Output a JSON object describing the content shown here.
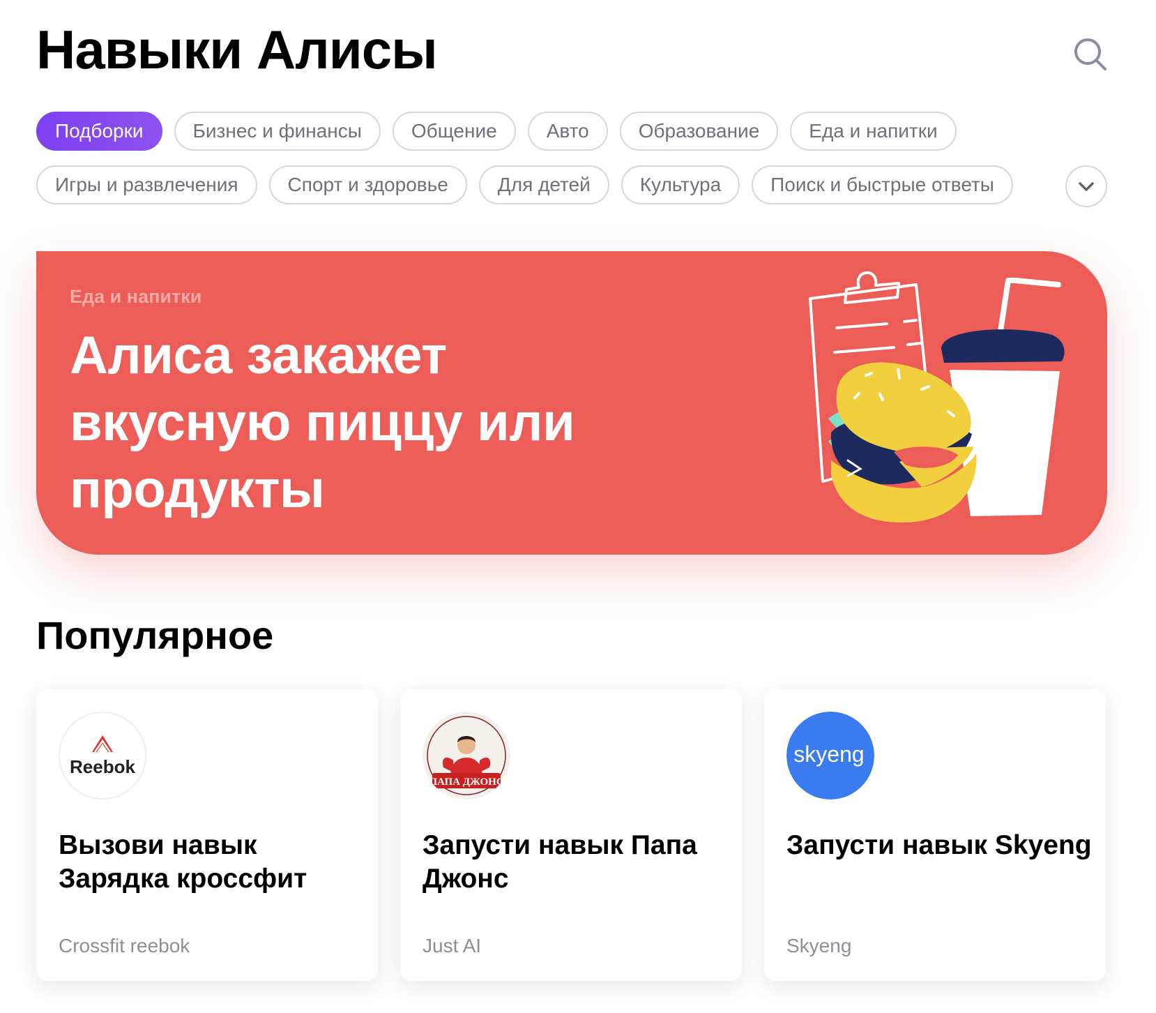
{
  "header": {
    "title": "Навыки Алисы",
    "search_icon": "search-icon"
  },
  "categories": {
    "row1": [
      "Подборки",
      "Бизнес и финансы",
      "Общение",
      "Авто",
      "Образование",
      "Еда и напитки"
    ],
    "row2": [
      "Игры и развлечения",
      "Спорт и здоровье",
      "Для детей",
      "Культура",
      "Поиск и быстрые ответы"
    ],
    "active": "Подборки",
    "expand_icon": "chevron-down-icon"
  },
  "banner": {
    "category": "Еда и напитки",
    "title": "Алиса закажет вкусную пиццу или продукты",
    "background": "#ec5d57"
  },
  "popular": {
    "title": "Популярное",
    "cards": [
      {
        "title": "Вызови навык Зарядка кроссфит",
        "author": "Crossfit reebok",
        "logo_text": "Reebok"
      },
      {
        "title": "Запусти навык Папа Джонс",
        "author": "Just AI",
        "logo_text": "ПАПА ДЖОНС"
      },
      {
        "title": "Запусти навык Skyeng",
        "author": "Skyeng",
        "logo_text": "skyeng"
      }
    ]
  },
  "colors": {
    "accent": "#7d3ff0",
    "chip_border": "#d6d7e0",
    "skyeng_blue": "#3b7bf0"
  }
}
